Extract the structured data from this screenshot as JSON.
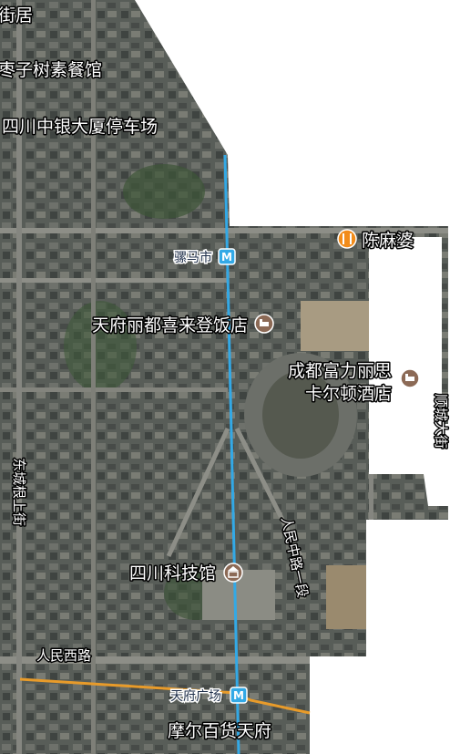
{
  "map": {
    "colors": {
      "outside": "#ffffff",
      "imagery_base": "#4a4f4c",
      "metro_line": "#33a9e6",
      "road_orange": "#e89b2a",
      "poi_orange": "#f28c1a",
      "poi_brown": "#8c6a56"
    },
    "metro_stations": [
      {
        "name": "骡马市",
        "icon": "metro-M-icon"
      },
      {
        "name": "天府广场",
        "icon": "metro-M-icon"
      }
    ],
    "pois": [
      {
        "name": "陈麻婆",
        "icon": "restaurant-icon"
      },
      {
        "name": "天府丽都喜来登饭店",
        "icon": "hotel-icon"
      },
      {
        "name": "成都富力丽思",
        "name2": "卡尔顿酒店",
        "icon": "hotel-icon"
      },
      {
        "name": "四川科技馆",
        "icon": "museum-icon"
      },
      {
        "name": "四川中银大厦停车场"
      },
      {
        "name": "枣子树素餐馆"
      },
      {
        "name": "摩尔百货天府"
      }
    ],
    "roads": {
      "top_street": "街居",
      "renmin_west": "人民西路",
      "dongchenggen": "东城根上街",
      "renmin_middle": "人民中路一段",
      "right_edge": "顺城大街"
    }
  }
}
